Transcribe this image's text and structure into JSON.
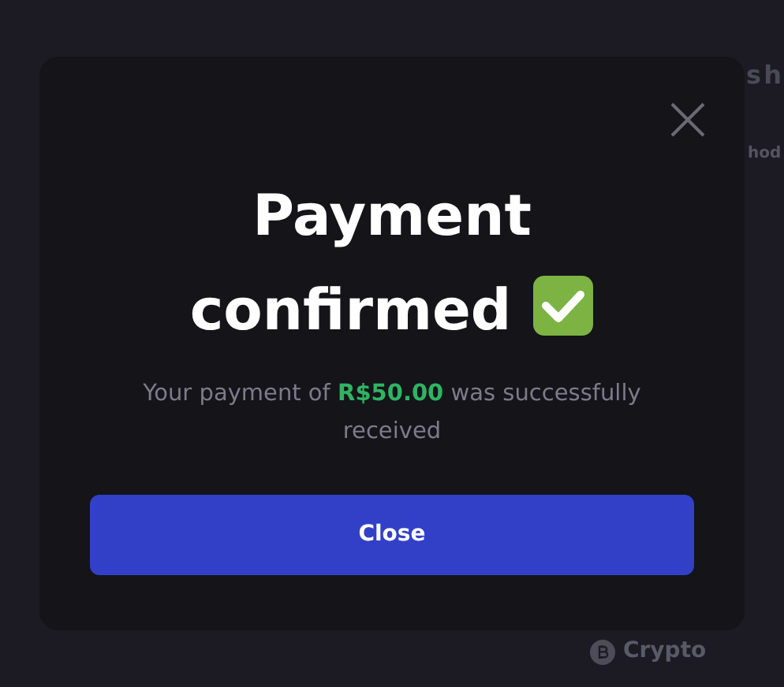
{
  "background": {
    "heading": "s h",
    "label": "hod",
    "payment_option": "Crypto"
  },
  "modal": {
    "title": "Payment confirmed",
    "message": "Your payment of **R$50.00** was successfully received",
    "button": "Close"
  }
}
